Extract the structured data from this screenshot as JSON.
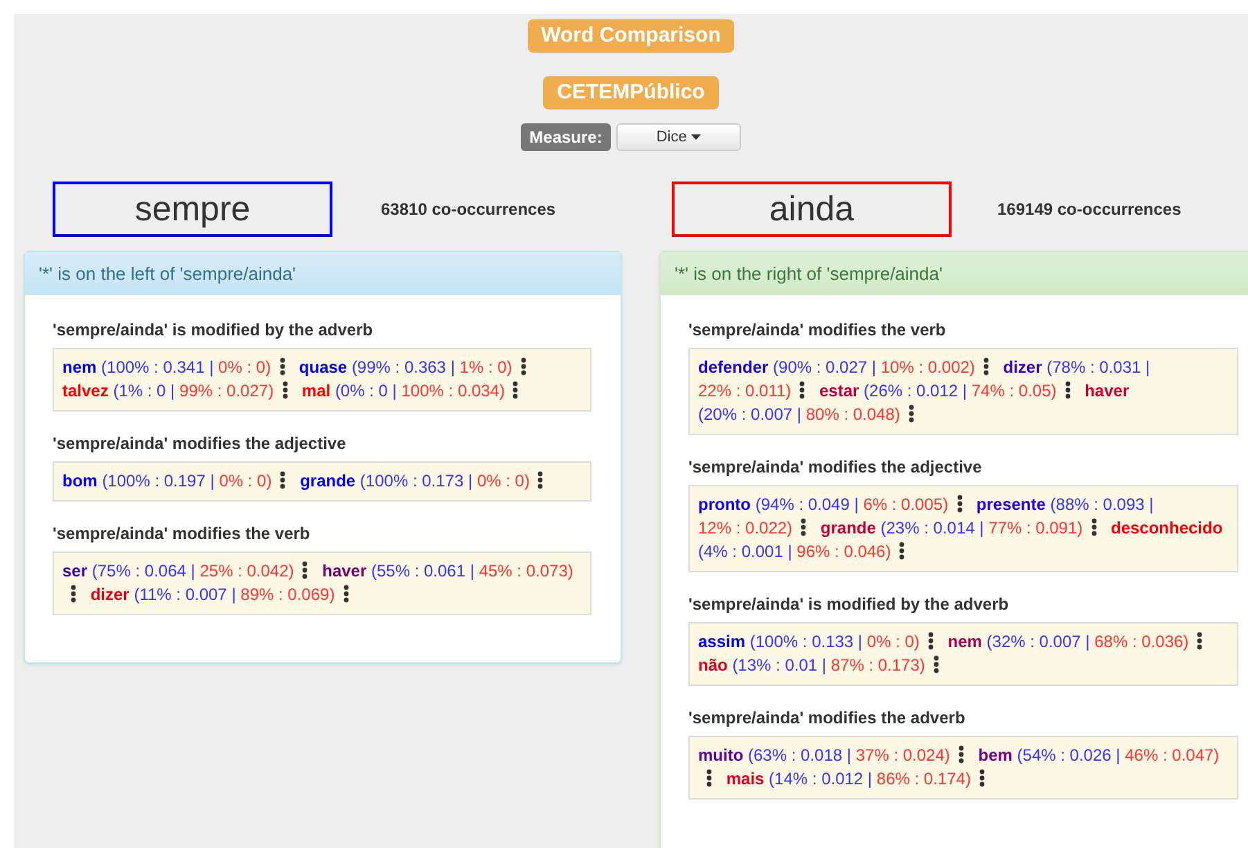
{
  "title": "Word Comparison",
  "corpus": "CETEMPúblico",
  "measure": {
    "label": "Measure:",
    "value": "Dice"
  },
  "words": [
    {
      "word": "sempre",
      "color": "#0000ff",
      "count": "63810 co-occurrences"
    },
    {
      "word": "ainda",
      "color": "#ff0000",
      "count": "169149 co-occurrences"
    }
  ],
  "panels": [
    {
      "kind": "left",
      "heading": "'*' is on the left of 'sempre/ainda'",
      "sections": [
        {
          "heading": "'sempre/ainda' is modified by the adverb",
          "entries": [
            {
              "word": "nem",
              "color": "#0000ff",
              "first": "(100% : 0.341 |",
              "second": "0% : 0)"
            },
            {
              "word": "quase",
              "color": "#0300fc",
              "first": "(99% : 0.363 |",
              "second": "1% : 0)"
            },
            {
              "word": "talvez",
              "color": "#fc0003",
              "first": "(1% : 0 |",
              "second": "99% : 0.027)"
            },
            {
              "word": "mal",
              "color": "#ff0000",
              "first": "(0% : 0 |",
              "second": "100% : 0.034)"
            }
          ]
        },
        {
          "heading": "'sempre/ainda' modifies the adjective",
          "entries": [
            {
              "word": "bom",
              "color": "#0000ff",
              "first": "(100% : 0.197 |",
              "second": "0% : 0)"
            },
            {
              "word": "grande",
              "color": "#0000ff",
              "first": "(100% : 0.173 |",
              "second": "0% : 0)"
            }
          ]
        },
        {
          "heading": "'sempre/ainda' modifies the verb",
          "entries": [
            {
              "word": "ser",
              "color": "#3f00bf",
              "first": "(75% : 0.064 |",
              "second": "25% : 0.042)"
            },
            {
              "word": "haver",
              "color": "#720072",
              "first": "(55% : 0.061 |",
              "second": "45% : 0.073)"
            },
            {
              "word": "dizer",
              "color": "#e2001c",
              "first": "(11% : 0.007 |",
              "second": "89% : 0.069)"
            }
          ]
        }
      ]
    },
    {
      "kind": "right",
      "heading": "'*' is on the right of 'sempre/ainda'",
      "sections": [
        {
          "heading": "'sempre/ainda' modifies the verb",
          "entries": [
            {
              "word": "defender",
              "color": "#1900e5",
              "first": "(90% : 0.027 |",
              "second": "10% : 0.002)"
            },
            {
              "word": "dizer",
              "color": "#3800c7",
              "first": "(78% : 0.031 |",
              "second": "22% : 0.011)"
            },
            {
              "word": "estar",
              "color": "#bd0042",
              "first": "(26% : 0.012 |",
              "second": "74% : 0.05)"
            },
            {
              "word": "haver",
              "color": "#cc0033",
              "first": "(20% : 0.007 |",
              "second": "80% : 0.048)"
            }
          ]
        },
        {
          "heading": "'sempre/ainda' modifies the adjective",
          "entries": [
            {
              "word": "pronto",
              "color": "#0f00f0",
              "first": "(94% : 0.049 |",
              "second": "6% : 0.005)"
            },
            {
              "word": "presente",
              "color": "#1f00e0",
              "first": "(88% : 0.093 |",
              "second": "12% : 0.022)"
            },
            {
              "word": "grande",
              "color": "#c4003b",
              "first": "(23% : 0.014 |",
              "second": "77% : 0.091)"
            },
            {
              "word": "desconhecido",
              "color": "#f5000a",
              "first": "(4% : 0.001 |",
              "second": "96% : 0.046)"
            }
          ]
        },
        {
          "heading": "'sempre/ainda' is modified by the adverb",
          "entries": [
            {
              "word": "assim",
              "color": "#0000ff",
              "first": "(100% : 0.133 |",
              "second": "0% : 0)"
            },
            {
              "word": "nem",
              "color": "#ad0052",
              "first": "(32% : 0.007 |",
              "second": "68% : 0.036)"
            },
            {
              "word": "não",
              "color": "#dd0022",
              "first": "(13% : 0.01 |",
              "second": "87% : 0.173)"
            }
          ]
        },
        {
          "heading": "'sempre/ainda' modifies the adverb",
          "entries": [
            {
              "word": "muito",
              "color": "#5e00a1",
              "first": "(63% : 0.018 |",
              "second": "37% : 0.024)"
            },
            {
              "word": "bem",
              "color": "#750089",
              "first": "(54% : 0.026 |",
              "second": "46% : 0.047)"
            },
            {
              "word": "mais",
              "color": "#db0024",
              "first": "(14% : 0.012 |",
              "second": "86% : 0.174)"
            }
          ]
        }
      ]
    }
  ]
}
